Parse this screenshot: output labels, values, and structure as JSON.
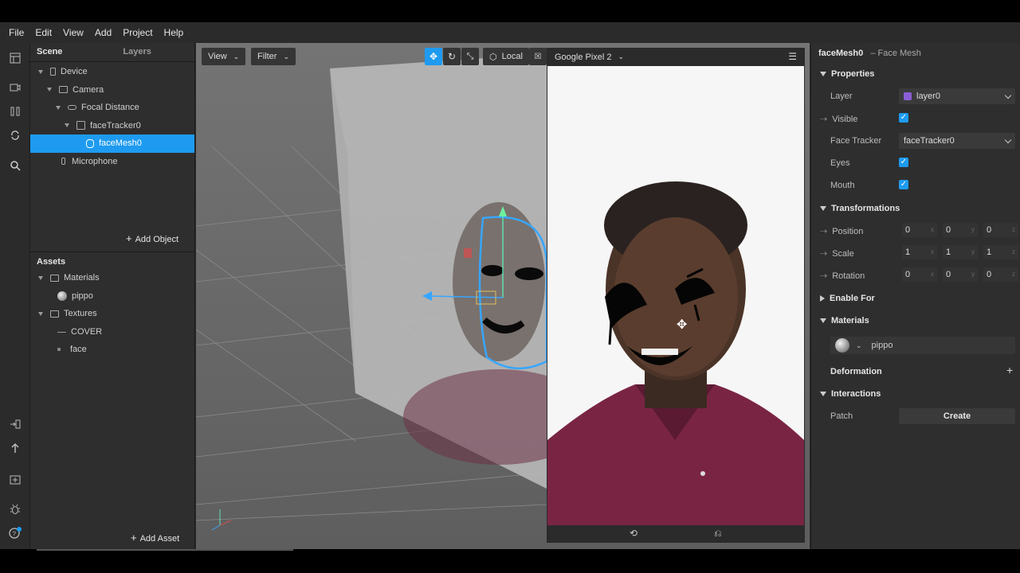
{
  "menu": [
    "File",
    "Edit",
    "View",
    "Add",
    "Project",
    "Help"
  ],
  "scene_panel": {
    "tab_scene": "Scene",
    "tab_layers": "Layers",
    "tree": [
      {
        "label": "Device",
        "depth": 0
      },
      {
        "label": "Camera",
        "depth": 1
      },
      {
        "label": "Focal Distance",
        "depth": 2
      },
      {
        "label": "faceTracker0",
        "depth": 3
      },
      {
        "label": "faceMesh0",
        "depth": 4,
        "selected": true
      },
      {
        "label": "Microphone",
        "depth": 1
      }
    ],
    "add_object": "Add Object"
  },
  "assets_panel": {
    "title": "Assets",
    "tree": [
      {
        "label": "Materials",
        "depth": 0
      },
      {
        "label": "pippo",
        "depth": 1
      },
      {
        "label": "Textures",
        "depth": 0
      },
      {
        "label": "COVER",
        "depth": 1
      },
      {
        "label": "face",
        "depth": 1
      }
    ],
    "add_asset": "Add Asset"
  },
  "viewport": {
    "view_btn": "View",
    "filter_btn": "Filter",
    "local_btn": "Local",
    "device": "Google Pixel 2"
  },
  "inspector": {
    "object_name": "faceMesh0",
    "object_type": "– Face Mesh",
    "properties_title": "Properties",
    "layer_label": "Layer",
    "layer_value": "layer0",
    "layer_color": "#8a5fd6",
    "visible_label": "Visible",
    "face_tracker_label": "Face Tracker",
    "face_tracker_value": "faceTracker0",
    "eyes_label": "Eyes",
    "mouth_label": "Mouth",
    "transformations_title": "Transformations",
    "position_label": "Position",
    "position": [
      "0",
      "0",
      "0"
    ],
    "scale_label": "Scale",
    "scale": [
      "1",
      "1",
      "1"
    ],
    "rotation_label": "Rotation",
    "rotation": [
      "0",
      "0",
      "0"
    ],
    "enable_for_title": "Enable For",
    "materials_title": "Materials",
    "material_value": "pippo",
    "deformation_label": "Deformation",
    "interactions_title": "Interactions",
    "patch_label": "Patch",
    "create_btn": "Create"
  },
  "colors": {
    "accent": "#1e9bf0",
    "panel": "#2e2e2e"
  }
}
